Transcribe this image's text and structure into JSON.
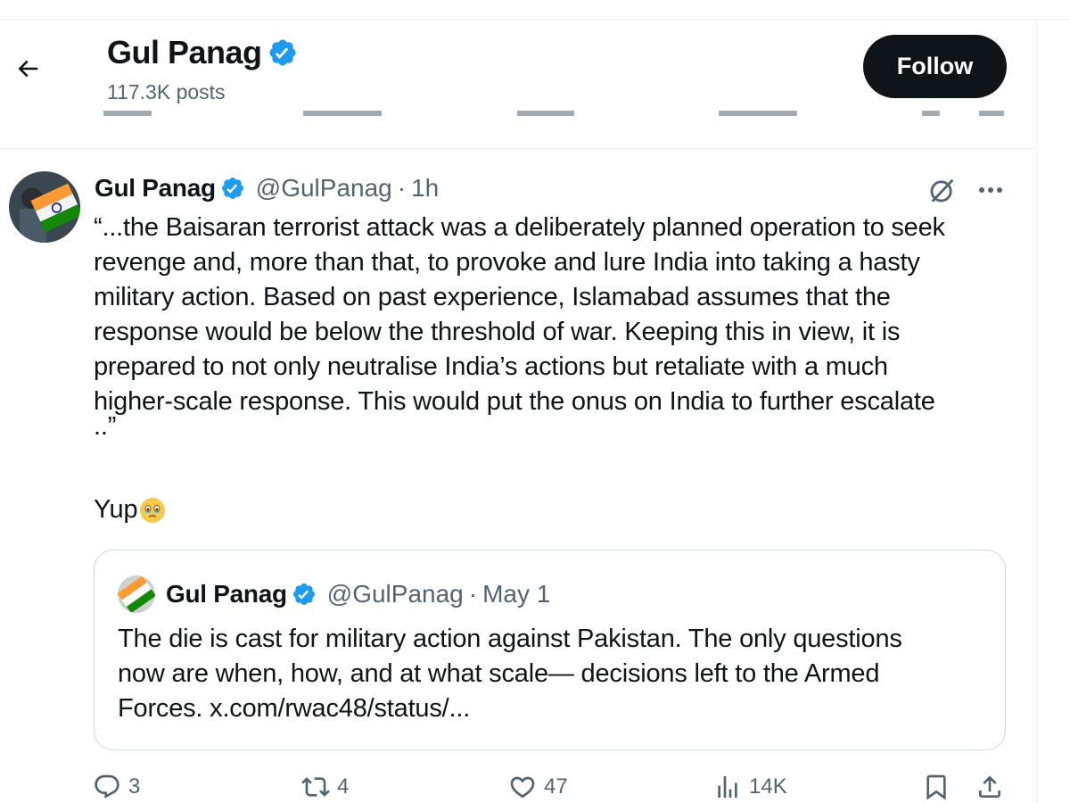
{
  "header": {
    "back_icon": "arrow-left-icon",
    "name": "Gul Panag",
    "verified_icon": "verified-badge-icon",
    "posts_count": "117.3K posts",
    "follow_label": "Follow"
  },
  "tweet": {
    "author_name": "Gul Panag",
    "handle": "@GulPanag",
    "separator": "·",
    "time": "1h",
    "grok_icon": "grok-icon",
    "more_icon": "more-horizontal-icon",
    "text_lines": [
      "“...the Baisaran terrorist attack was a deliberately planned operation to seek",
      "revenge and, more than that, to provoke and lure India into taking a hasty",
      "military action. Based on past experience, Islamabad assumes that the",
      "response would be below the threshold of war. Keeping this in view, it is",
      "prepared to not only neutralise India’s actions but retaliate with a much",
      "higher-scale response. This would put the onus on India to further escalate",
      "..”"
    ],
    "reply_text": "Yup",
    "reply_emoji": "face-holding-back-tears-emoji"
  },
  "quote": {
    "author_name": "Gul Panag",
    "handle": "@GulPanag",
    "separator": "·",
    "time": "May 1",
    "text_lines": [
      "The die is cast for military action against Pakistan. The only questions",
      "now are when, how, and at what scale— decisions left to the Armed",
      "Forces. x.com/rwac48/status/..."
    ]
  },
  "actions": {
    "replies": "3",
    "reposts": "4",
    "likes": "47",
    "views": "14K"
  },
  "colors": {
    "text": "#0f1419",
    "secondary": "#536471",
    "verified": "#1d9bf0",
    "follow_bg": "#0f1419",
    "border": "#cfd9de"
  }
}
